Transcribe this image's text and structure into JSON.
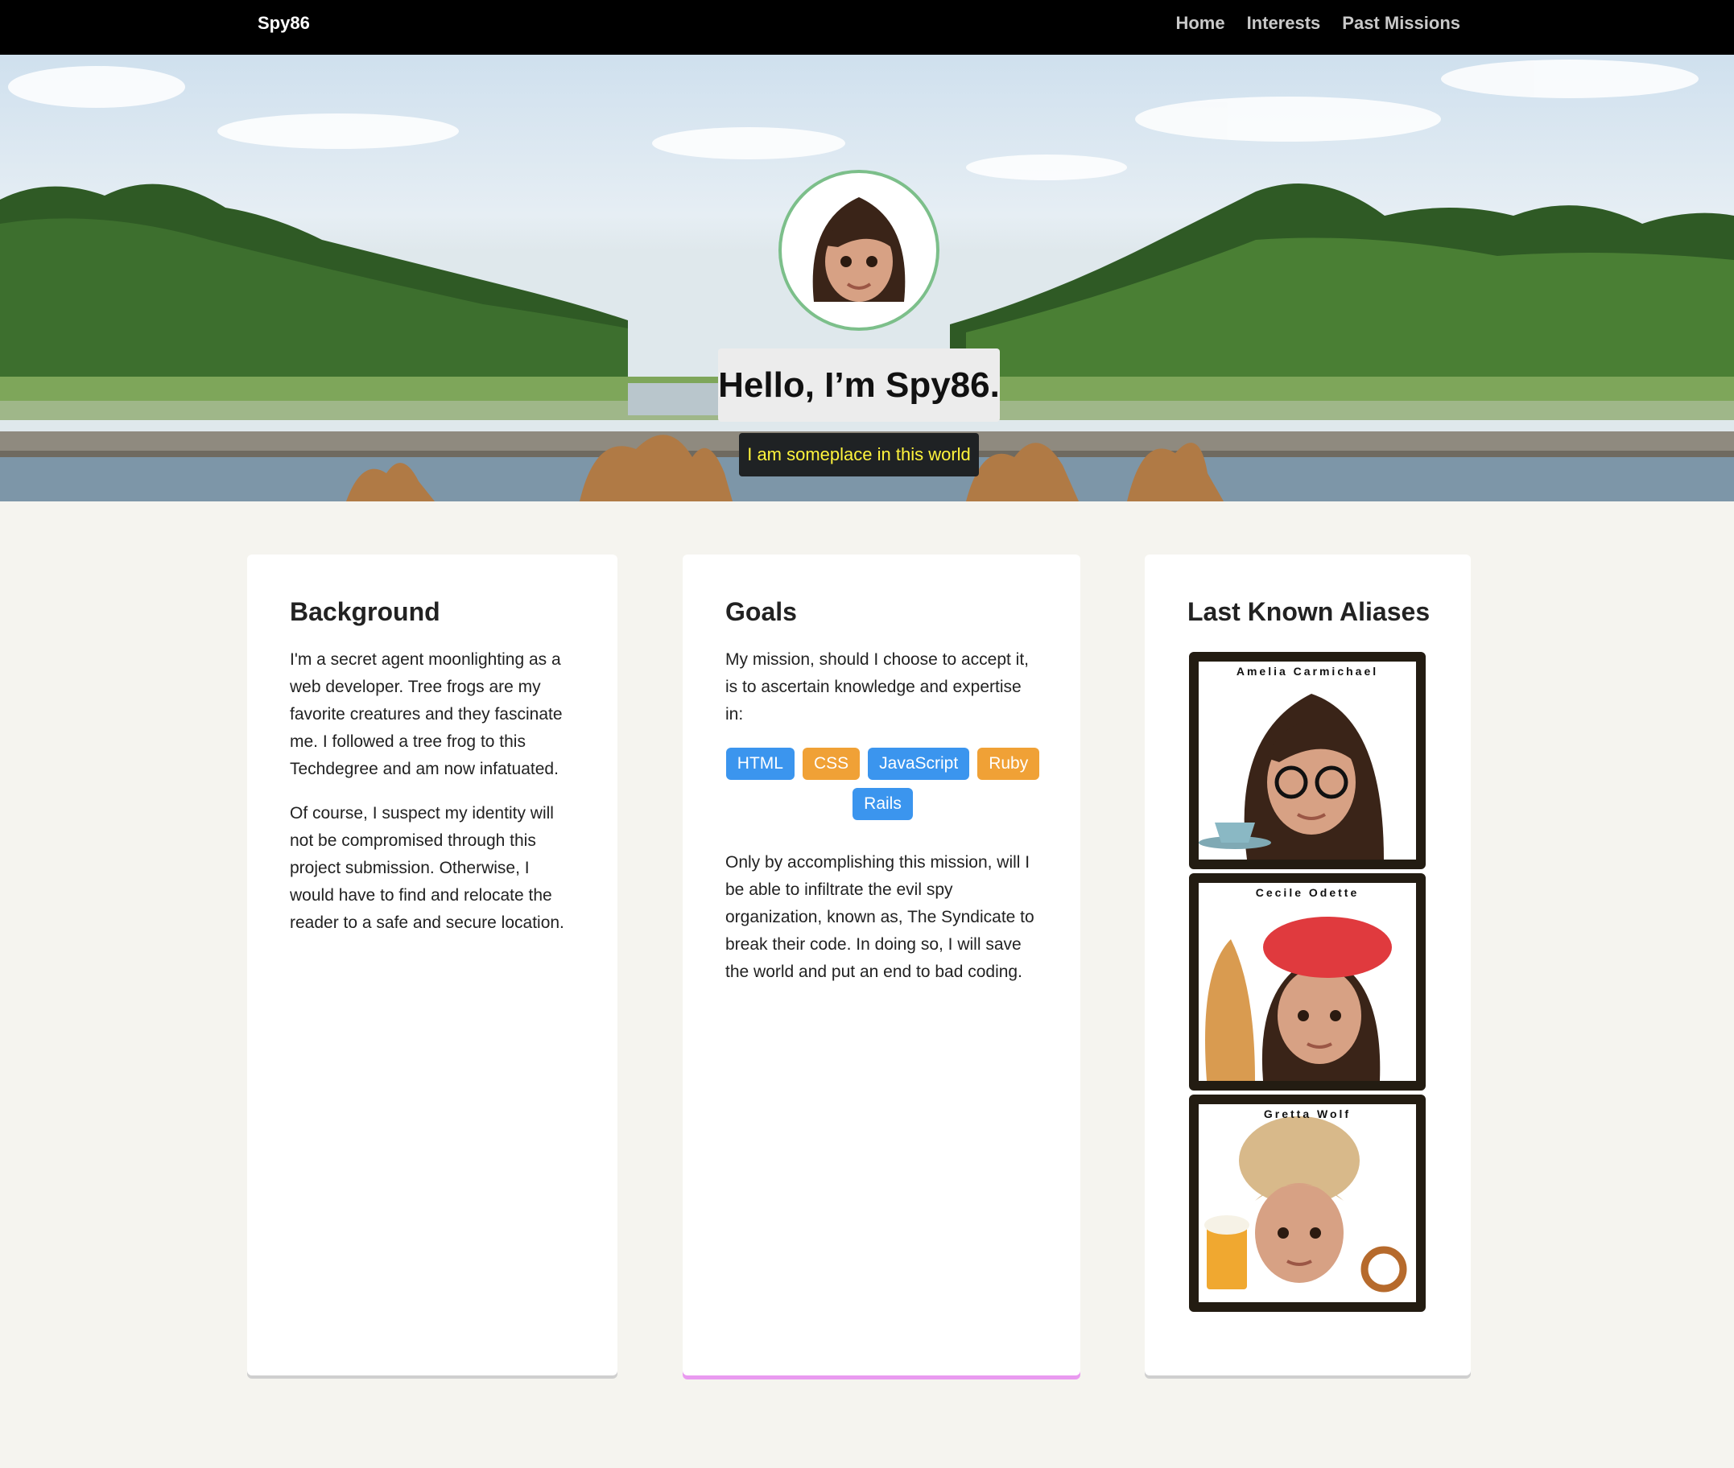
{
  "nav": {
    "brand": "Spy86",
    "links": [
      "Home",
      "Interests",
      "Past Missions"
    ]
  },
  "hero": {
    "title": "Hello, I’m Spy86.",
    "subtitle": "I am someplace in this world"
  },
  "cards": {
    "background": {
      "title": "Background",
      "paragraphs": [
        "I'm a secret agent moonlighting as a web developer. Tree frogs are my favorite creatures and they fascinate me. I followed a tree frog to this Techdegree and am now infatuated.",
        "Of course, I suspect my identity will not be compromised through this project submission. Otherwise, I would have to find and relocate the reader to a safe and secure location."
      ]
    },
    "goals": {
      "title": "Goals",
      "intro": "My mission, should I choose to accept it, is to ascertain knowledge and expertise in:",
      "tags": [
        "HTML",
        "CSS",
        "JavaScript",
        "Ruby",
        "Rails"
      ],
      "outro": "Only by accomplishing this mission, will I be able to infiltrate the evil spy organization, known as, The Syndicate to break their code. In doing so, I will save the world and put an end to bad coding."
    },
    "aliases": {
      "title": "Last Known Aliases",
      "items": [
        "Amelia Carmichael",
        "Cecile Odette",
        "Gretta Wolf"
      ]
    }
  },
  "colors": {
    "tag_blue": "#3b95ee",
    "tag_orange": "#f0a136",
    "subtitle_text": "#fff43c",
    "goals_accent": "#e99af0"
  }
}
